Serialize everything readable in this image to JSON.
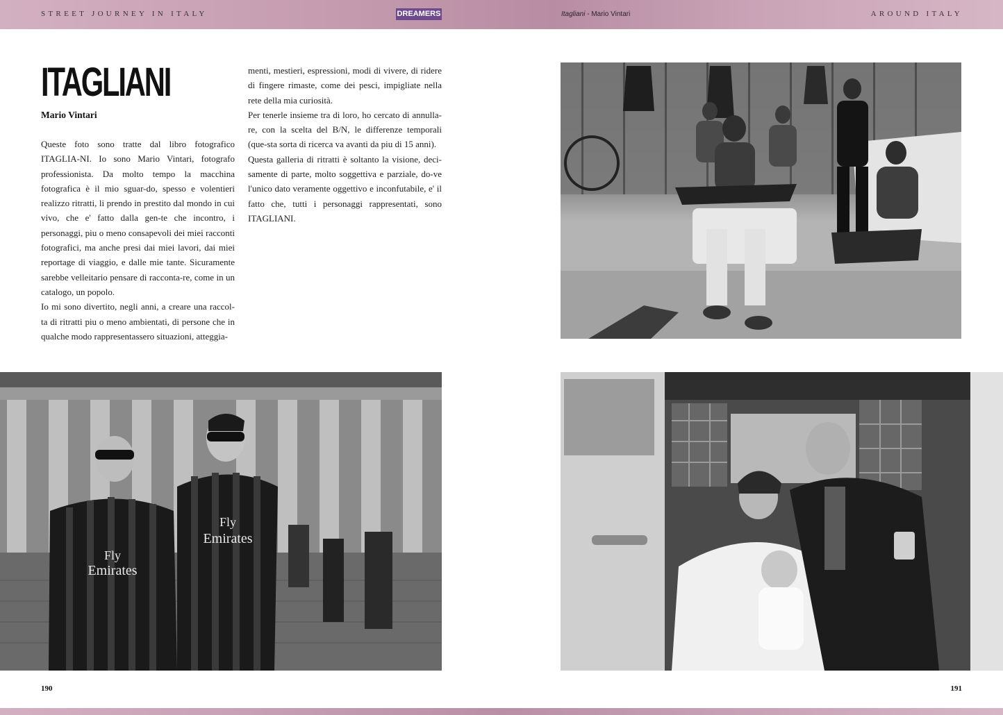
{
  "header": {
    "left_title": "STREET JOURNEY IN ITALY",
    "badge": "DREAMERS",
    "center_title_italic": "Itagliani",
    "center_title_rest": " - Mario Vintari",
    "right_title": "AROUND ITALY"
  },
  "article": {
    "title": "ITAGLIANI",
    "author": "Mario Vintari",
    "column1": [
      "Queste foto sono tratte dal libro fotografico ITAGLIA-NI. Io sono Mario Vintari, fotografo professionista. Da molto tempo la macchina fotografica è il mio sguar-do, spesso e volentieri realizzo ritratti, li prendo in prestito dal mondo in cui vivo, che e' fatto dalla gen-te che incontro, i personaggi, piu o meno consapevoli dei miei racconti fotografici, ma anche presi dai miei lavori, dai miei reportage di viaggio, e dalle mie tante. Sicuramente sarebbe velleitario pensare di racconta-re, come in un catalogo, un popolo.",
      "Io mi sono divertito, negli anni, a creare una raccol-ta di ritratti piu o meno ambientati, di persone che in qualche modo rappresentassero situazioni, atteggia-"
    ],
    "column2": [
      "menti, mestieri, espressioni, modi di vivere, di ridere di fingere rimaste, come dei pesci, impigliate nella rete della mia curiosità.",
      "Per tenerle insieme tra di loro, ho cercato di annulla-re, con la scelta del B/N, le differenze temporali (que-sta sorta di ricerca va avanti da piu di 15 anni).",
      "Questa galleria di ritratti è soltanto la visione, deci-samente di parte, molto soggettiva e parziale, do-ve l'unico dato veramente oggettivo e inconfutabile, e' il fatto che, tutti i personaggi rappresentati, sono ITAGLIANI."
    ]
  },
  "photos": {
    "shirt_text_1": "Fly",
    "shirt_text_2": "Emirates"
  },
  "footer": {
    "page_left": "190",
    "page_right": "191"
  },
  "colors": {
    "band": "#c49aae",
    "badge": "#6e4a8c"
  }
}
